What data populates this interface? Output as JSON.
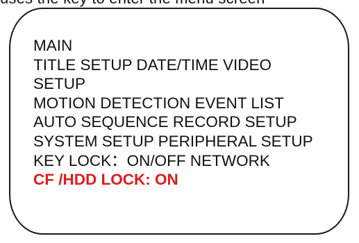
{
  "caption": {
    "text": "uses the key to enter the menu screen"
  },
  "menu": {
    "items": [
      {
        "label": "MAIN"
      },
      {
        "label": "TITLE SETUP DATE/TIME VIDEO"
      },
      {
        "label": "SETUP"
      },
      {
        "label": "MOTION DETECTION EVENT LIST"
      },
      {
        "label": "AUTO SEQUENCE RECORD SETUP"
      },
      {
        "label": "SYSTEM SETUP PERIPHERAL SETUP"
      },
      {
        "label": "KEY LOCK：ON/OFF NETWORK"
      },
      {
        "label": "CF /HDD LOCK: ON",
        "highlighted": true
      }
    ]
  },
  "colors": {
    "text": "#111111",
    "highlight": "#e01c1c",
    "frame_border": "#1a1a1a",
    "background": "#ffffff"
  }
}
